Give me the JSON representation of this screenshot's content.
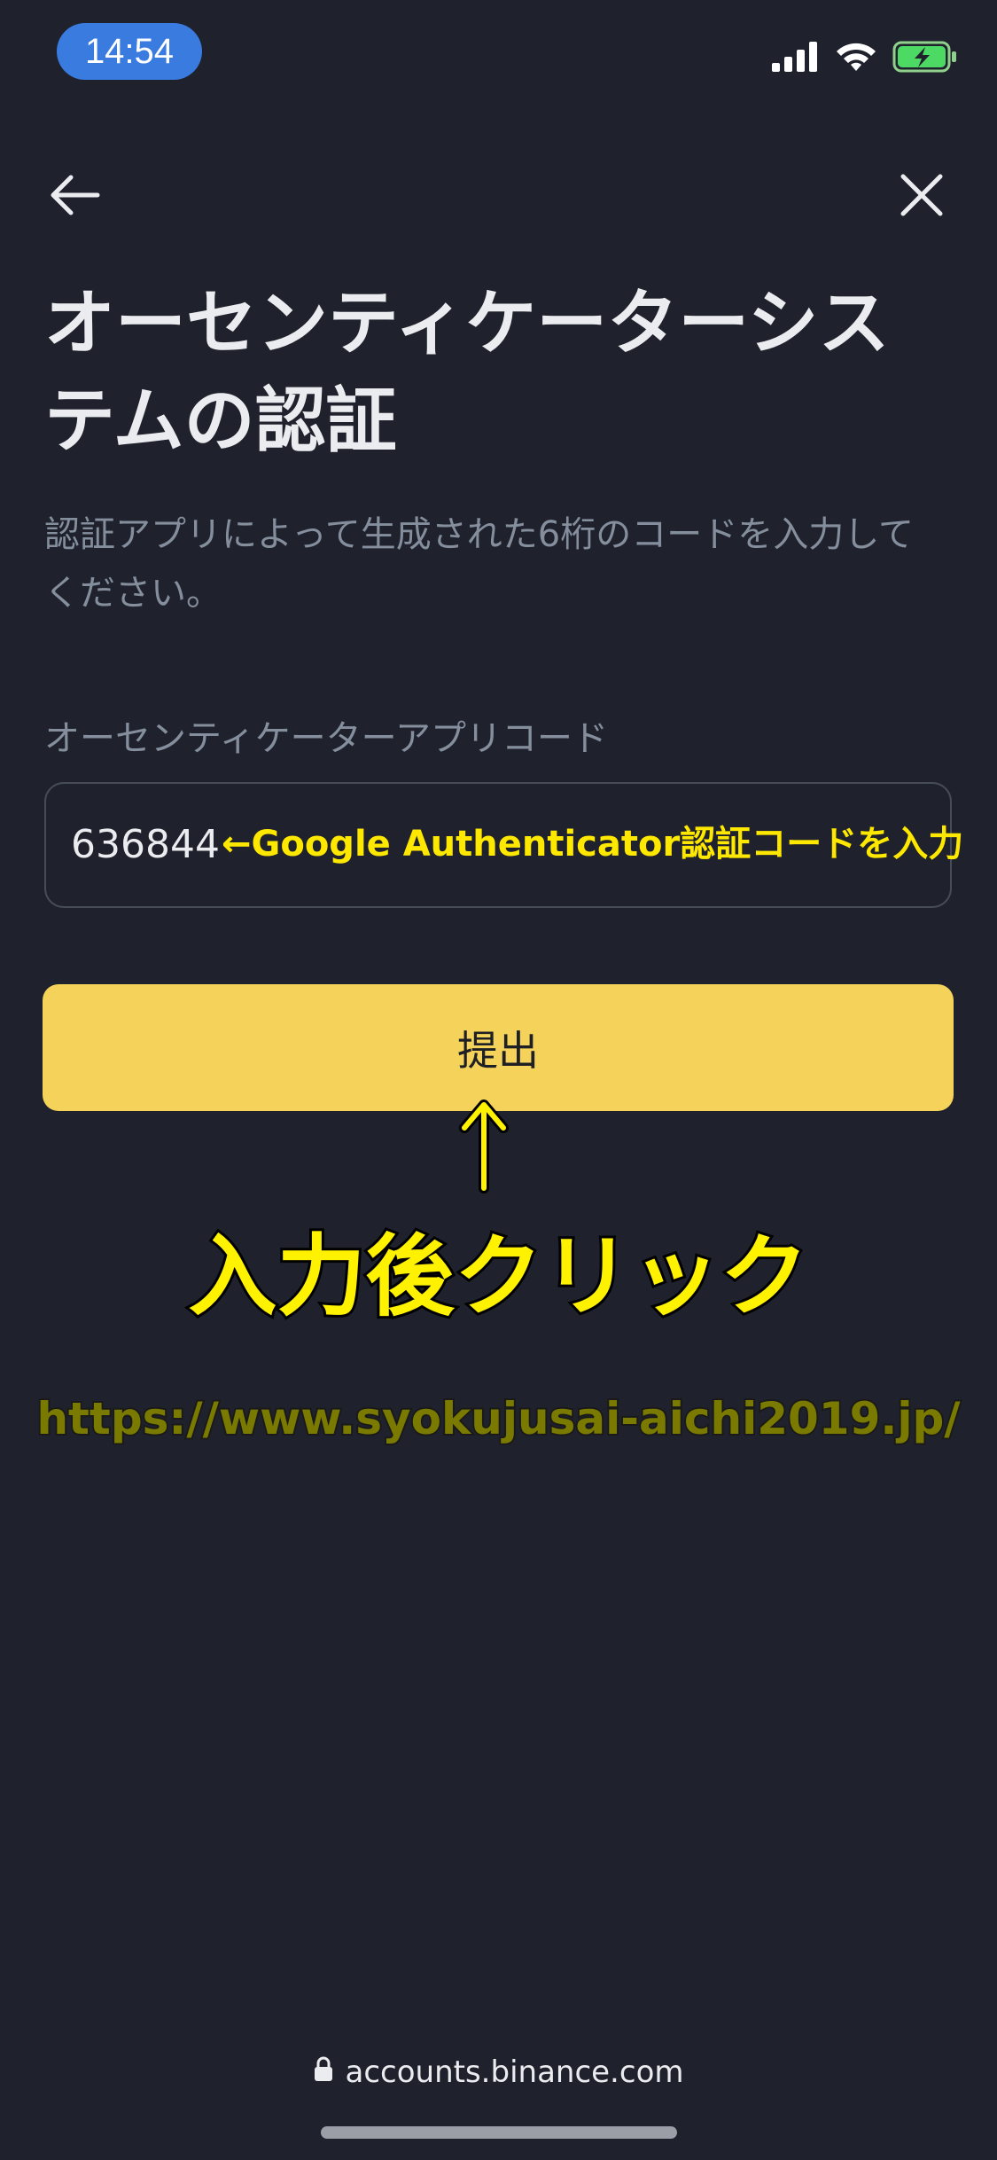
{
  "status_bar": {
    "time": "14:54",
    "time_pill_color": "#3a7be0",
    "icons": [
      "signal-icon",
      "wifi-icon",
      "battery-charging-icon"
    ]
  },
  "nav": {
    "back_icon": "arrow-left-icon",
    "close_icon": "close-icon"
  },
  "page": {
    "title": "オーセンティケーターシステムの認証",
    "description": "認証アプリによって生成された6桁のコードを入力してください。"
  },
  "form": {
    "field_label": "オーセンティケーターアプリコード",
    "code_value": "636844",
    "submit_label": "提出",
    "submit_color": "#f5d35a"
  },
  "overlay_annotations": {
    "field_note": "←Google Authenticator認証コードを入力",
    "click_note": "入力後クリック",
    "url": "https://www.syokujusai-aichi2019.jp/",
    "arrow_icon": "up-arrow-icon",
    "annotation_color": "#fff200"
  },
  "browser": {
    "address": "accounts.binance.com",
    "lock_icon": "lock-icon"
  }
}
